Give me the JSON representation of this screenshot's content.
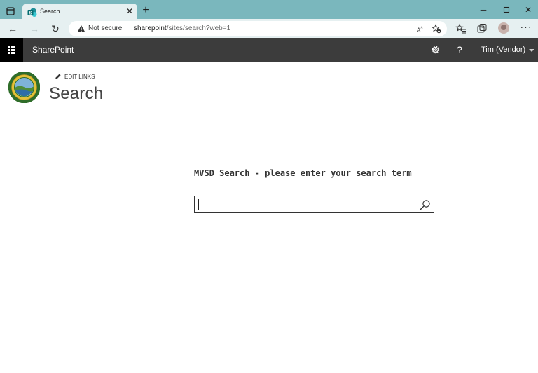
{
  "browser": {
    "tab": {
      "title": "Search"
    },
    "address": {
      "security_label": "Not secure",
      "url_host": "sharepoint",
      "url_path": "/sites/search?web=1"
    }
  },
  "suitebar": {
    "brand": "SharePoint",
    "help_label": "?",
    "user_name": "Tim (Vendor)"
  },
  "page": {
    "edit_links_label": "EDIT LINKS",
    "title": "Search",
    "search_prompt": "MVSD Search - please enter your search term",
    "search_value": ""
  },
  "colors": {
    "tabstrip": "#7ab7bd",
    "toolbar": "#e6f0f1",
    "suitebar": "#3c3c3c",
    "waffle": "#000000"
  }
}
